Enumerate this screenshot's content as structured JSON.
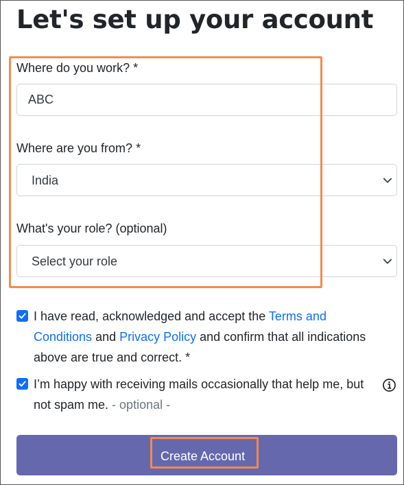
{
  "page": {
    "title": "Let's set up your account"
  },
  "form": {
    "workplace": {
      "label": "Where do you work? *",
      "value": "ABC"
    },
    "country": {
      "label": "Where are you from? *",
      "selected": "India"
    },
    "role": {
      "label": "What's your role? (optional)",
      "selected": "Select your role"
    }
  },
  "consent": {
    "terms": {
      "checked": true,
      "text_before": "I have read, acknowledged and accept the ",
      "terms_link": "Terms and Conditions",
      "text_middle": " and ",
      "privacy_link": "Privacy Policy",
      "text_after": " and confirm that all indications above are true and correct. *"
    },
    "mails": {
      "checked": true,
      "text": "I’m happy with receiving mails occasionally that help me, but not spam me. ",
      "optional_tag": "- optional -",
      "info_icon": "info-circle-icon"
    }
  },
  "actions": {
    "submit_label": "Create Account"
  },
  "colors": {
    "highlight": "#f58a4b",
    "primary_button": "#6668ae",
    "link": "#0d6efd",
    "checkbox": "#0d6efd"
  }
}
